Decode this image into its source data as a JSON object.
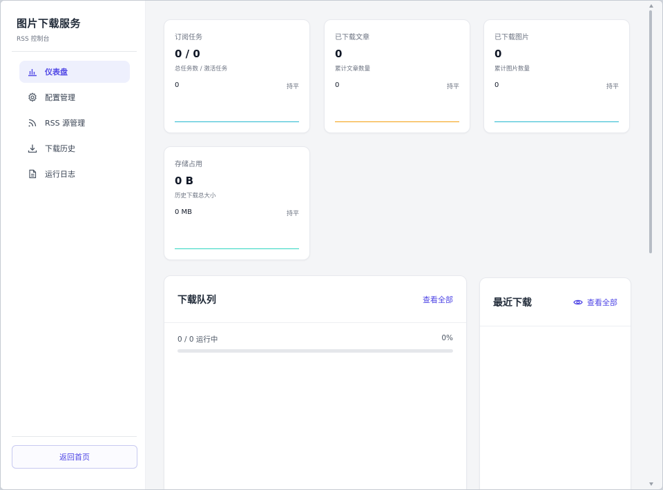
{
  "sidebar": {
    "title": "图片下载服务",
    "subtitle": "RSS 控制台",
    "items": [
      {
        "label": "仪表盘",
        "icon": "bar-chart-icon",
        "active": true
      },
      {
        "label": "配置管理",
        "icon": "gear-icon",
        "active": false
      },
      {
        "label": "RSS 源管理",
        "icon": "rss-icon",
        "active": false
      },
      {
        "label": "下载历史",
        "icon": "download-icon",
        "active": false
      },
      {
        "label": "运行日志",
        "icon": "document-icon",
        "active": false
      }
    ],
    "back_label": "返回首页"
  },
  "stats": [
    {
      "label": "订阅任务",
      "value": "0 / 0",
      "desc": "总任务数 / 激活任务",
      "num": "0",
      "trend": "持平",
      "line_color": "#22b8cf"
    },
    {
      "label": "已下载文章",
      "value": "0",
      "desc": "累计文章数量",
      "num": "0",
      "trend": "持平",
      "line_color": "#f59e0b"
    },
    {
      "label": "已下载图片",
      "value": "0",
      "desc": "累计图片数量",
      "num": "0",
      "trend": "持平",
      "line_color": "#22b8cf"
    },
    {
      "label": "存储占用",
      "value": "0 B",
      "desc": "历史下载总大小",
      "num": "0 MB",
      "trend": "持平",
      "line_color": "#2dd4bf"
    }
  ],
  "queue": {
    "title": "下载队列",
    "link": "查看全部",
    "status": "0 / 0 运行中",
    "percent": "0%",
    "progress": 0
  },
  "recent": {
    "title": "最近下载",
    "link": "查看全部",
    "link_icon": "eye-icon"
  },
  "colors": {
    "accent": "#4f46e5",
    "active_bg": "#eef0fd"
  }
}
